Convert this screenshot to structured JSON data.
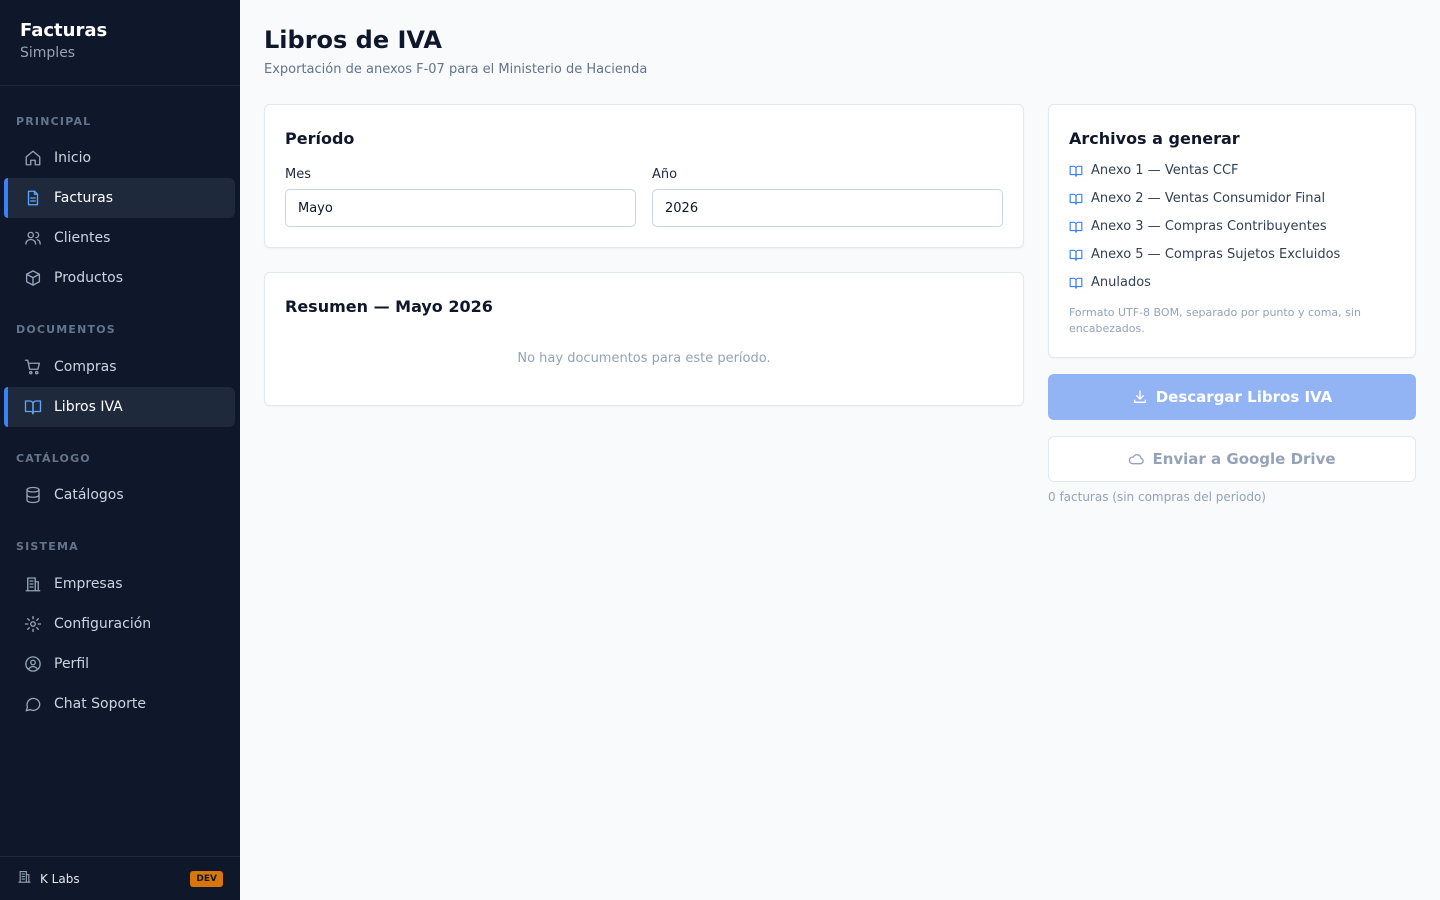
{
  "brand": {
    "title": "Facturas",
    "subtitle": "Simples"
  },
  "sidebar": {
    "sections": {
      "principal": "PRINCIPAL",
      "documentos": "DOCUMENTOS",
      "catalogo": "CATÁLOGO",
      "sistema": "SISTEMA"
    },
    "items": [
      {
        "label": "Inicio",
        "icon": "home-icon"
      },
      {
        "label": "Facturas",
        "icon": "file-text-icon",
        "active": true
      },
      {
        "label": "Clientes",
        "icon": "users-icon"
      },
      {
        "label": "Productos",
        "icon": "package-icon"
      },
      {
        "label": "Compras",
        "icon": "cart-icon"
      },
      {
        "label": "Libros IVA",
        "icon": "book-open-icon",
        "active": true
      },
      {
        "label": "Catálogos",
        "icon": "database-icon"
      },
      {
        "label": "Empresas",
        "icon": "building-icon"
      },
      {
        "label": "Configuración",
        "icon": "gear-icon"
      },
      {
        "label": "Perfil",
        "icon": "user-circle-icon"
      },
      {
        "label": "Chat Soporte",
        "icon": "chat-icon"
      }
    ],
    "footer": {
      "name": "K Labs",
      "badge": "DEV"
    }
  },
  "header": {
    "title": "Libros de IVA",
    "subtitle": "Exportación de anexos F-07 para el Ministerio de Hacienda"
  },
  "periodo": {
    "title": "Período",
    "mes_label": "Mes",
    "mes_value": "Mayo",
    "anio_label": "Año",
    "anio_value": "2026"
  },
  "resumen": {
    "title": "Resumen — Mayo 2026",
    "empty": "No hay documentos para este período."
  },
  "archivos": {
    "title": "Archivos a generar",
    "items": [
      "Anexo 1 — Ventas CCF",
      "Anexo 2 — Ventas Consumidor Final",
      "Anexo 3 — Compras Contribuyentes",
      "Anexo 5 — Compras Sujetos Excluidos",
      "Anulados"
    ],
    "note": "Formato UTF-8 BOM, separado por punto y coma, sin encabezados."
  },
  "actions": {
    "download": "Descargar Libros IVA",
    "drive": "Enviar a Google Drive",
    "count_note": "0 facturas (sin compras del periodo)"
  },
  "colors": {
    "sidebar_bg": "#0f172a",
    "accent": "#3b82f6",
    "primary_disabled": "#93b4f4"
  }
}
